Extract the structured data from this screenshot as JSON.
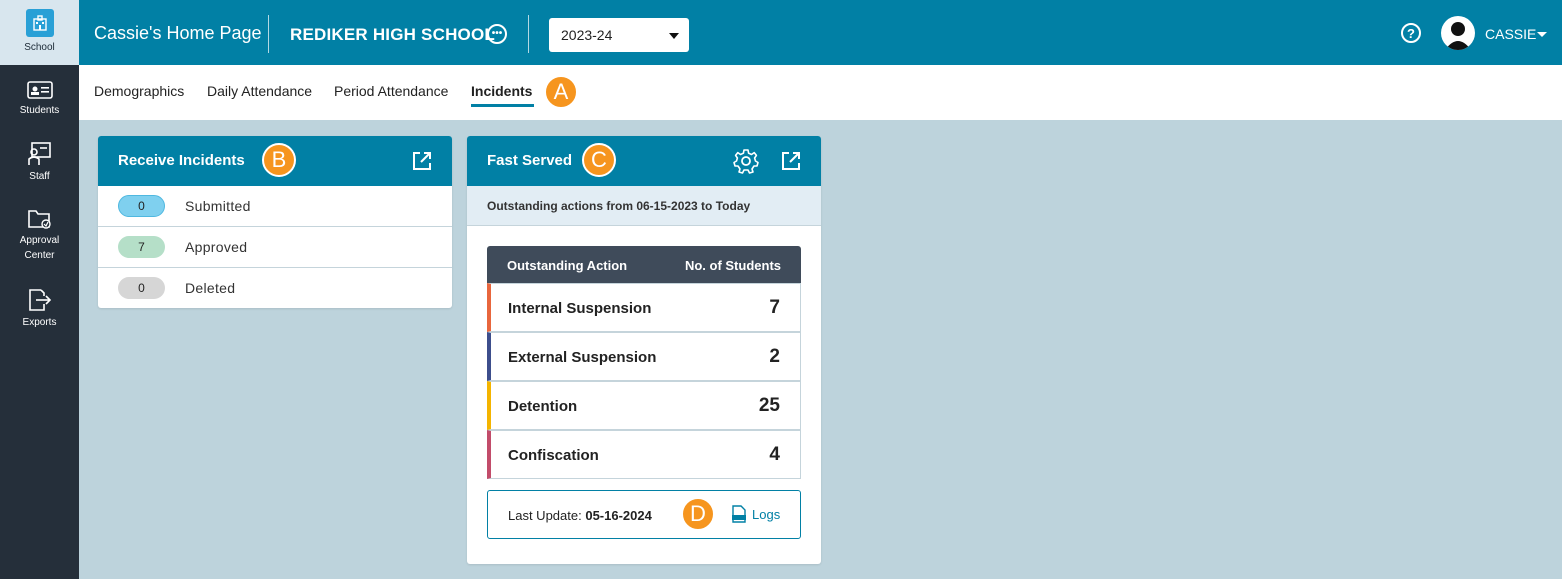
{
  "sidebar": {
    "items": [
      {
        "label": "School",
        "icon": "school-icon"
      },
      {
        "label": "Students",
        "icon": "student-card-icon"
      },
      {
        "label": "Staff",
        "icon": "staff-icon"
      },
      {
        "label": "Approval",
        "label2": "Center",
        "icon": "folder-approval-icon"
      },
      {
        "label": "Exports",
        "icon": "export-icon"
      }
    ]
  },
  "header": {
    "home_title": "Cassie's Home Page",
    "school_name": "REDIKER HIGH SCHOOL",
    "year": "2023-24",
    "user_name": "CASSIE"
  },
  "tabs": [
    {
      "label": "Demographics"
    },
    {
      "label": "Daily Attendance"
    },
    {
      "label": "Period Attendance"
    },
    {
      "label": "Incidents",
      "active": true
    }
  ],
  "markers": {
    "a": "A",
    "b": "B",
    "c": "C",
    "d": "D"
  },
  "receive_incidents": {
    "title": "Receive Incidents",
    "rows": [
      {
        "count": "0",
        "label": "Submitted",
        "color": "#7fd0ef"
      },
      {
        "count": "7",
        "label": "Approved",
        "color": "#b5dfc8"
      },
      {
        "count": "0",
        "label": "Deleted",
        "color": "#d6d6d6"
      }
    ]
  },
  "fast_served": {
    "title": "Fast Served",
    "outstanding_text": "Outstanding actions from 06-15-2023 to Today",
    "col_action": "Outstanding Action",
    "col_students": "No. of Students",
    "rows": [
      {
        "label": "Internal Suspension",
        "count": "7",
        "color": "#e8663d"
      },
      {
        "label": "External Suspension",
        "count": "2",
        "color": "#3d4e8c"
      },
      {
        "label": "Detention",
        "count": "25",
        "color": "#f4b400"
      },
      {
        "label": "Confiscation",
        "count": "4",
        "color": "#c24c6a"
      }
    ],
    "last_update_label": "Last Update:",
    "last_update_value": "05-16-2024",
    "logs_label": "Logs"
  },
  "colors": {
    "brand": "#0180a5",
    "sidebar": "#252f3a",
    "background": "#bdd3dc",
    "marker": "#f6951e"
  }
}
